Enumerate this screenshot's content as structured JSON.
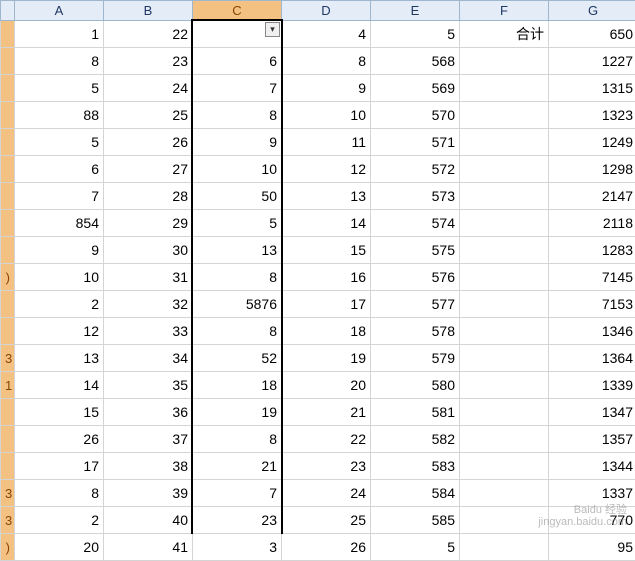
{
  "chart_data": {
    "type": "table",
    "columns": [
      "A",
      "B",
      "C",
      "D",
      "E",
      "F",
      "G"
    ],
    "rows": [
      {
        "n": "",
        "A": "1",
        "B": "22",
        "C": "",
        "D": "4",
        "E": "5",
        "F": "合计",
        "G": "650"
      },
      {
        "n": "",
        "A": "8",
        "B": "23",
        "C": "6",
        "D": "8",
        "E": "568",
        "F": "",
        "G": "1227"
      },
      {
        "n": "",
        "A": "5",
        "B": "24",
        "C": "7",
        "D": "9",
        "E": "569",
        "F": "",
        "G": "1315"
      },
      {
        "n": "",
        "A": "88",
        "B": "25",
        "C": "8",
        "D": "10",
        "E": "570",
        "F": "",
        "G": "1323"
      },
      {
        "n": "",
        "A": "5",
        "B": "26",
        "C": "9",
        "D": "11",
        "E": "571",
        "F": "",
        "G": "1249"
      },
      {
        "n": "",
        "A": "6",
        "B": "27",
        "C": "10",
        "D": "12",
        "E": "572",
        "F": "",
        "G": "1298"
      },
      {
        "n": "",
        "A": "7",
        "B": "28",
        "C": "50",
        "D": "13",
        "E": "573",
        "F": "",
        "G": "2147"
      },
      {
        "n": "",
        "A": "854",
        "B": "29",
        "C": "5",
        "D": "14",
        "E": "574",
        "F": "",
        "G": "2118"
      },
      {
        "n": "",
        "A": "9",
        "B": "30",
        "C": "13",
        "D": "15",
        "E": "575",
        "F": "",
        "G": "1283"
      },
      {
        "n": ")",
        "A": "10",
        "B": "31",
        "C": "8",
        "D": "16",
        "E": "576",
        "F": "",
        "G": "7145"
      },
      {
        "n": "",
        "A": "2",
        "B": "32",
        "C": "5876",
        "D": "17",
        "E": "577",
        "F": "",
        "G": "7153"
      },
      {
        "n": "",
        "A": "12",
        "B": "33",
        "C": "8",
        "D": "18",
        "E": "578",
        "F": "",
        "G": "1346"
      },
      {
        "n": "3",
        "A": "13",
        "B": "34",
        "C": "52",
        "D": "19",
        "E": "579",
        "F": "",
        "G": "1364"
      },
      {
        "n": "1",
        "A": "14",
        "B": "35",
        "C": "18",
        "D": "20",
        "E": "580",
        "F": "",
        "G": "1339"
      },
      {
        "n": "",
        "A": "15",
        "B": "36",
        "C": "19",
        "D": "21",
        "E": "581",
        "F": "",
        "G": "1347"
      },
      {
        "n": "",
        "A": "26",
        "B": "37",
        "C": "8",
        "D": "22",
        "E": "582",
        "F": "",
        "G": "1357"
      },
      {
        "n": "",
        "A": "17",
        "B": "38",
        "C": "21",
        "D": "23",
        "E": "583",
        "F": "",
        "G": "1344"
      },
      {
        "n": "3",
        "A": "8",
        "B": "39",
        "C": "7",
        "D": "24",
        "E": "584",
        "F": "",
        "G": "1337"
      },
      {
        "n": "3",
        "A": "2",
        "B": "40",
        "C": "23",
        "D": "25",
        "E": "585",
        "F": "",
        "G": "770"
      },
      {
        "n": ")",
        "A": "20",
        "B": "41",
        "C": "3",
        "D": "26",
        "E": "5",
        "F": "",
        "G": "95"
      }
    ]
  },
  "headers": {
    "A": "A",
    "B": "B",
    "C": "C",
    "D": "D",
    "E": "E",
    "F": "F",
    "G": "G"
  },
  "watermark": {
    "brand": "Baidu 经验",
    "url": "jingyan.baidu.com"
  }
}
